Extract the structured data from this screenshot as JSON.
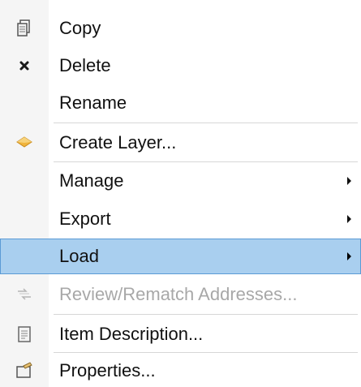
{
  "context_menu": {
    "items": [
      {
        "label": "Copy",
        "icon": "copy-icon",
        "enabled": true,
        "submenu": false
      },
      {
        "label": "Delete",
        "icon": "delete-x-icon",
        "enabled": true,
        "submenu": false
      },
      {
        "label": "Rename",
        "icon": "",
        "enabled": true,
        "submenu": false
      },
      {
        "label": "Create Layer...",
        "icon": "layer-diamond-icon",
        "enabled": true,
        "submenu": false
      },
      {
        "label": "Manage",
        "icon": "",
        "enabled": true,
        "submenu": true
      },
      {
        "label": "Export",
        "icon": "",
        "enabled": true,
        "submenu": true
      },
      {
        "label": "Load",
        "icon": "",
        "enabled": true,
        "submenu": true,
        "highlighted": true
      },
      {
        "label": "Review/Rematch Addresses...",
        "icon": "rematch-addresses-icon",
        "enabled": false,
        "submenu": false
      },
      {
        "label": "Item Description...",
        "icon": "item-description-icon",
        "enabled": true,
        "submenu": false
      },
      {
        "label": "Properties...",
        "icon": "properties-icon",
        "enabled": true,
        "submenu": false
      }
    ]
  },
  "colors": {
    "highlight_fill": "#a9cfef",
    "highlight_border": "#5b9bd5",
    "disabled_text": "#a8a8a8",
    "delete_icon": "#1a1a1a",
    "layer_icon": "#f0b43c"
  }
}
